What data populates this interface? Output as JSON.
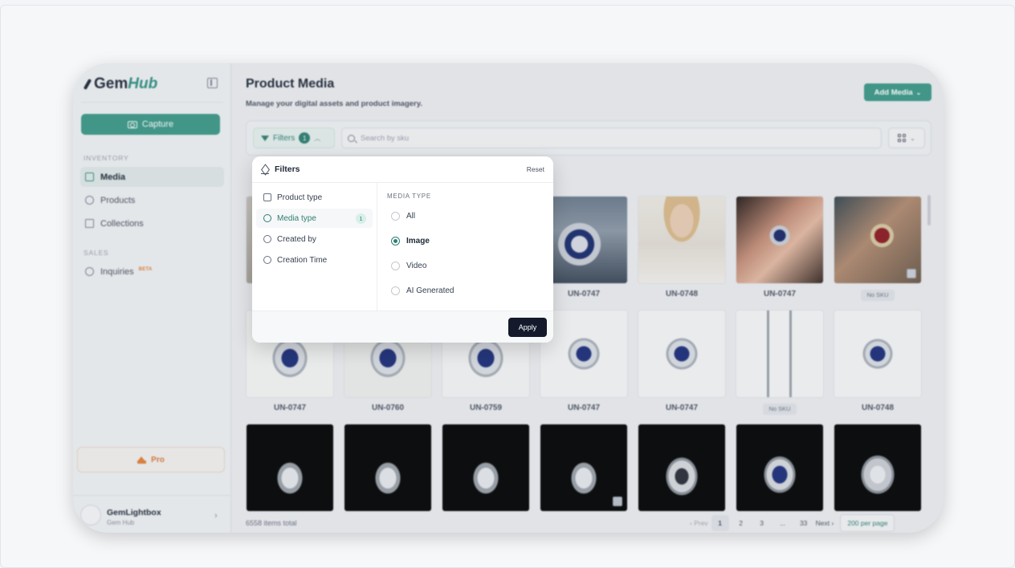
{
  "sidebar": {
    "brand_prefix": "Gem",
    "brand_suffix": "Hub",
    "capture_label": "Capture",
    "inventory_label": "INVENTORY",
    "items": [
      {
        "label": "Media",
        "icon": "image-icon"
      },
      {
        "label": "Products",
        "icon": "box-icon"
      },
      {
        "label": "Collections",
        "icon": "book-icon"
      }
    ],
    "sales_label": "SALES",
    "inquiries_label": "Inquiries",
    "beta_badge": "BETA",
    "pro_label": "Pro",
    "account_name": "GemLightbox",
    "account_sub": "Gem Hub"
  },
  "header": {
    "title": "Product Media",
    "subtitle": "Manage your digital assets and product imagery.",
    "add_media_label": "Add Media"
  },
  "toolbar": {
    "filters_label": "Filters",
    "filters_count": "1",
    "search_placeholder": "Search by sku"
  },
  "filters_popover": {
    "title": "Filters",
    "reset_label": "Reset",
    "categories": [
      {
        "label": "Product type",
        "count": ""
      },
      {
        "label": "Media type",
        "count": "1"
      },
      {
        "label": "Created by",
        "count": ""
      },
      {
        "label": "Creation Time",
        "count": ""
      }
    ],
    "media_type_heading": "MEDIA TYPE",
    "options": [
      "All",
      "Image",
      "Video",
      "AI Generated"
    ],
    "selected_option": "Image",
    "apply_label": "Apply"
  },
  "gallery": {
    "rows": [
      [
        "UN-0747",
        "UN-0748",
        "UN-0747",
        "No SKU"
      ],
      [
        "UN-0747",
        "UN-0760",
        "UN-0759",
        "UN-0747",
        "UN-0747",
        "No SKU",
        "UN-0748"
      ]
    ]
  },
  "footer": {
    "total_text": "6558 items total",
    "prev_label": "‹ Prev",
    "pages": [
      "1",
      "2",
      "3",
      "...",
      "33"
    ],
    "next_label": "Next ›",
    "per_page_label": "200 per page"
  },
  "colors": {
    "accent": "#3d9887",
    "dark_button": "#141a2b"
  }
}
